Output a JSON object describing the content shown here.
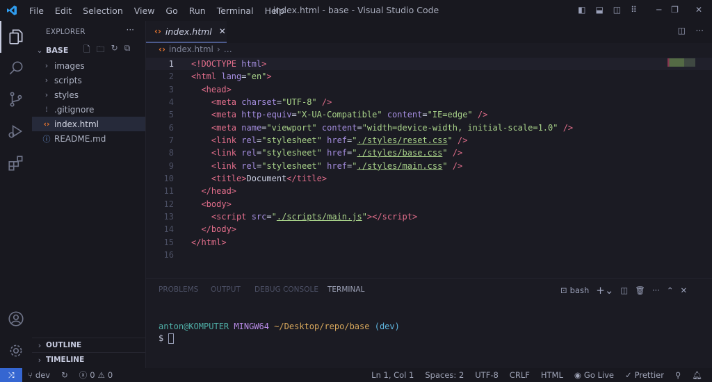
{
  "window": {
    "title": "index.html - base - Visual Studio Code"
  },
  "menu": [
    "File",
    "Edit",
    "Selection",
    "View",
    "Go",
    "Run",
    "Terminal",
    "Help"
  ],
  "sidebar": {
    "header": "EXPLORER",
    "more": "···",
    "folder": "BASE",
    "items": [
      {
        "label": "images",
        "type": "folder"
      },
      {
        "label": "scripts",
        "type": "folder"
      },
      {
        "label": "styles",
        "type": "folder"
      },
      {
        "label": ".gitignore",
        "type": "file"
      },
      {
        "label": "index.html",
        "type": "html",
        "selected": true
      },
      {
        "label": "README.md",
        "type": "md"
      }
    ],
    "outline": "OUTLINE",
    "timeline": "TIMELINE"
  },
  "editor": {
    "tab": "index.html",
    "breadcrumb": "index.html",
    "breadcrumb_more": "…",
    "lines": [
      [
        [
          "tag",
          "<!DOCTYPE "
        ],
        [
          "attr",
          "html"
        ],
        [
          "tag",
          ">"
        ]
      ],
      [
        [
          "tag",
          "<html "
        ],
        [
          "attr",
          "lang"
        ],
        [
          "txt",
          "="
        ],
        [
          "str",
          "\"en\""
        ],
        [
          "tag",
          ">"
        ]
      ],
      [
        [
          "txt",
          "  "
        ],
        [
          "tag",
          "<head>"
        ]
      ],
      [
        [
          "txt",
          "    "
        ],
        [
          "tag",
          "<meta "
        ],
        [
          "attr",
          "charset"
        ],
        [
          "txt",
          "="
        ],
        [
          "str",
          "\"UTF-8\""
        ],
        [
          "txt",
          " "
        ],
        [
          "tag",
          "/>"
        ]
      ],
      [
        [
          "txt",
          "    "
        ],
        [
          "tag",
          "<meta "
        ],
        [
          "attr",
          "http-equiv"
        ],
        [
          "txt",
          "="
        ],
        [
          "str",
          "\"X-UA-Compatible\""
        ],
        [
          "txt",
          " "
        ],
        [
          "attr",
          "content"
        ],
        [
          "txt",
          "="
        ],
        [
          "str",
          "\"IE=edge\""
        ],
        [
          "txt",
          " "
        ],
        [
          "tag",
          "/>"
        ]
      ],
      [
        [
          "txt",
          "    "
        ],
        [
          "tag",
          "<meta "
        ],
        [
          "attr",
          "name"
        ],
        [
          "txt",
          "="
        ],
        [
          "str",
          "\"viewport\""
        ],
        [
          "txt",
          " "
        ],
        [
          "attr",
          "content"
        ],
        [
          "txt",
          "="
        ],
        [
          "str",
          "\"width=device-width, initial-scale=1.0\""
        ],
        [
          "txt",
          " "
        ],
        [
          "tag",
          "/>"
        ]
      ],
      [
        [
          "txt",
          "    "
        ],
        [
          "tag",
          "<link "
        ],
        [
          "attr",
          "rel"
        ],
        [
          "txt",
          "="
        ],
        [
          "str",
          "\"stylesheet\""
        ],
        [
          "txt",
          " "
        ],
        [
          "attr",
          "href"
        ],
        [
          "txt",
          "="
        ],
        [
          "str",
          "\""
        ],
        [
          "link",
          "./styles/reset.css"
        ],
        [
          "str",
          "\""
        ],
        [
          "txt",
          " "
        ],
        [
          "tag",
          "/>"
        ]
      ],
      [
        [
          "txt",
          "    "
        ],
        [
          "tag",
          "<link "
        ],
        [
          "attr",
          "rel"
        ],
        [
          "txt",
          "="
        ],
        [
          "str",
          "\"stylesheet\""
        ],
        [
          "txt",
          " "
        ],
        [
          "attr",
          "href"
        ],
        [
          "txt",
          "="
        ],
        [
          "str",
          "\""
        ],
        [
          "link",
          "./styles/base.css"
        ],
        [
          "str",
          "\""
        ],
        [
          "txt",
          " "
        ],
        [
          "tag",
          "/>"
        ]
      ],
      [
        [
          "txt",
          "    "
        ],
        [
          "tag",
          "<link "
        ],
        [
          "attr",
          "rel"
        ],
        [
          "txt",
          "="
        ],
        [
          "str",
          "\"stylesheet\""
        ],
        [
          "txt",
          " "
        ],
        [
          "attr",
          "href"
        ],
        [
          "txt",
          "="
        ],
        [
          "str",
          "\""
        ],
        [
          "link",
          "./styles/main.css"
        ],
        [
          "str",
          "\""
        ],
        [
          "txt",
          " "
        ],
        [
          "tag",
          "/>"
        ]
      ],
      [
        [
          "txt",
          "    "
        ],
        [
          "tag",
          "<title>"
        ],
        [
          "txt",
          "Document"
        ],
        [
          "tag",
          "</title>"
        ]
      ],
      [
        [
          "txt",
          "  "
        ],
        [
          "tag",
          "</head>"
        ]
      ],
      [
        [
          "txt",
          "  "
        ],
        [
          "tag",
          "<body>"
        ]
      ],
      [
        [
          "txt",
          "    "
        ],
        [
          "tag",
          "<script "
        ],
        [
          "attr",
          "src"
        ],
        [
          "txt",
          "="
        ],
        [
          "str",
          "\""
        ],
        [
          "link",
          "./scripts/main.js"
        ],
        [
          "str",
          "\""
        ],
        [
          "tag",
          "></script>"
        ]
      ],
      [
        [
          "txt",
          "  "
        ],
        [
          "tag",
          "</body>"
        ]
      ],
      [
        [
          "tag",
          "</html>"
        ]
      ],
      []
    ]
  },
  "panel": {
    "tabs": [
      "PROBLEMS",
      "OUTPUT",
      "DEBUG CONSOLE",
      "TERMINAL"
    ],
    "active": 3,
    "shell": "bash",
    "prompt": {
      "user": "anton@KOMPUTER",
      "sys": "MINGW64",
      "path": "~/Desktop/repo/base",
      "branch": "(dev)",
      "dollar": "$"
    }
  },
  "status": {
    "branch": "dev",
    "errors": "0",
    "warnings": "0",
    "position": "Ln 1, Col 1",
    "spaces": "Spaces: 2",
    "encoding": "UTF-8",
    "eol": "CRLF",
    "language": "HTML",
    "golive": "Go Live",
    "prettier": "Prettier"
  },
  "colors": {
    "accent": "#3566d1",
    "tag": "#e26e8b",
    "attr": "#a58ee0",
    "string": "#a9d38a"
  }
}
